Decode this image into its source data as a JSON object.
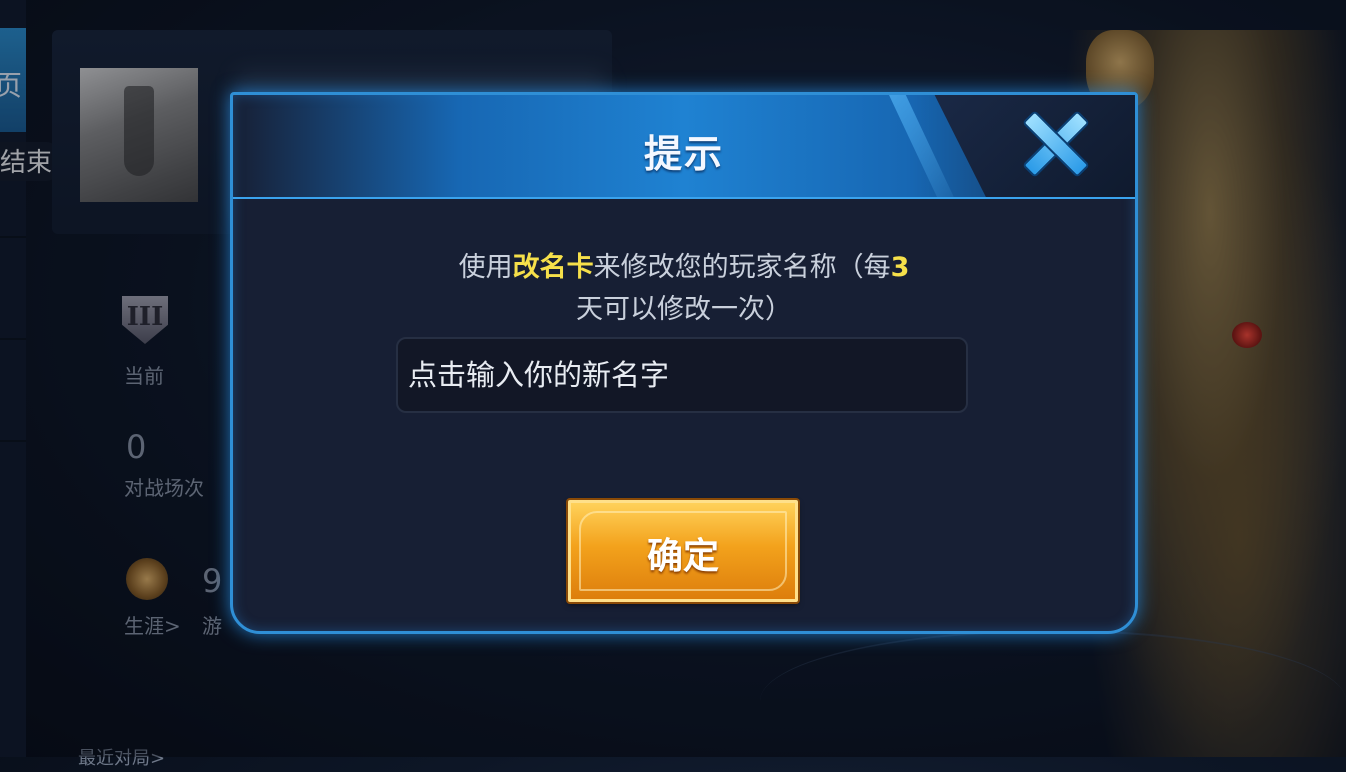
{
  "background": {
    "nav_tab_active": "页",
    "end_label": "结束",
    "rank_badge": "III",
    "rank_caption": "当前",
    "battle_count": "0",
    "battle_caption": "对战场次",
    "career_caption": "生涯>",
    "career_value": "9",
    "career_value_caption": "游",
    "recent_label": "最近对局>"
  },
  "dialog": {
    "title": "提示",
    "message": {
      "part1": "使用",
      "highlight1": "改名卡",
      "part2": "来修改您的玩家名称（每",
      "highlight2": "3",
      "part3": "天可以修改一次）"
    },
    "input": {
      "placeholder": "点击输入你的新名字",
      "value": ""
    },
    "confirm_label": "确定",
    "close_icon": "close-x-icon"
  },
  "colors": {
    "accent_blue": "#2f8fd6",
    "highlight_yellow": "#f6e04a",
    "button_orange": "#f3a21c",
    "dialog_bg": "#171f34"
  }
}
